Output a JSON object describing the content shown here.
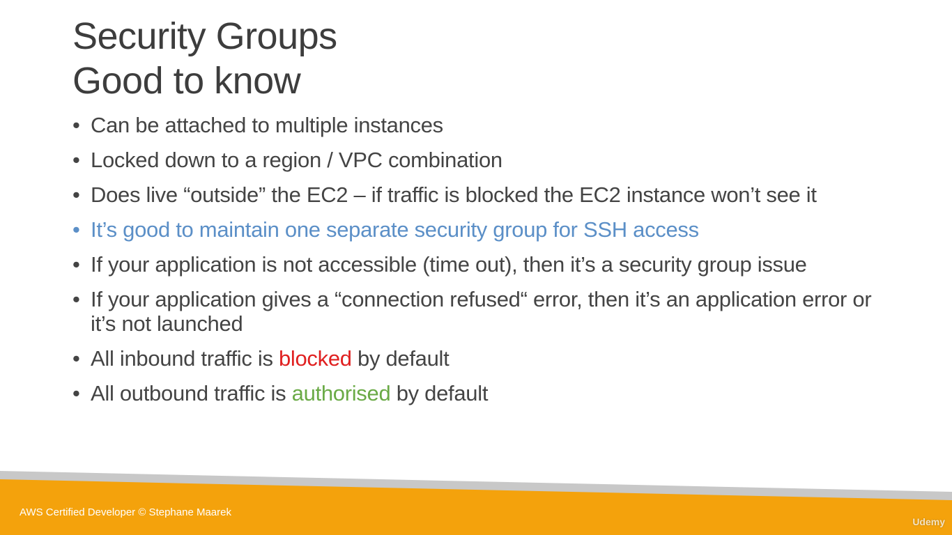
{
  "slide": {
    "title_line1": "Security Groups",
    "title_line2": "Good to know",
    "bullet_symbol": "•",
    "bullets": [
      {
        "text": "Can be attached to multiple instances"
      },
      {
        "text": "Locked down to a region / VPC combination"
      },
      {
        "text": "Does live “outside” the EC2 – if traffic is blocked the EC2 instance won’t see it"
      },
      {
        "text": "It’s good to maintain one separate security group for SSH access"
      },
      {
        "text": "If your application is not accessible (time out), then it’s a security group issue"
      },
      {
        "text": "If your application gives a “connection refused“ error, then it’s an application error or it’s not launched"
      },
      {
        "before": "All inbound traffic is ",
        "highlight": "blocked",
        "after": " by default"
      },
      {
        "before": "All outbound traffic is ",
        "highlight": "authorised",
        "after": " by default"
      }
    ]
  },
  "footer": {
    "credit": "AWS Certified Developer © Stephane Maarek",
    "watermark": "Udemy"
  },
  "colors": {
    "title": "#3d3d3d",
    "body_text": "#444444",
    "accent_blue": "#5b8fc7",
    "blocked_red": "#e02020",
    "authorised_green": "#6aaa46",
    "footer_orange": "#f4a20c",
    "footer_gray": "#c8c8c8"
  }
}
